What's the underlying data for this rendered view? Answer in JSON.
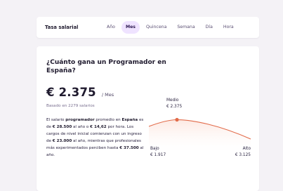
{
  "rate_bar": {
    "title": "Tasa salarial",
    "tabs": [
      "Año",
      "Mes",
      "Quincena",
      "Semana",
      "Día",
      "Hora"
    ],
    "active_tab": "Mes"
  },
  "main": {
    "question": "¿Cuánto gana un Programador en España?",
    "salary_amount": "€ 2.375",
    "salary_period": "/ Mes",
    "based_on": "Basado en 2279 salarios",
    "description": {
      "t1": "El salario ",
      "b1": "programador",
      "t2": " promedio en ",
      "b2": "España",
      "t3": " es de ",
      "b3": "€ 28.500",
      "t4": " al año o ",
      "b4": "€ 14,62",
      "t5": " por hora. Los cargos de nivel inicial comienzan con un ingreso de ",
      "b5": "€ 23.000",
      "t6": " al año, mientras que profesionales más experimentados perciben hasta ",
      "b6": "€ 37.500",
      "t7": " al año."
    },
    "chart": {
      "medio_label": "Medio",
      "medio_value": "€ 2.375",
      "bajo_label": "Bajo",
      "bajo_value": "€ 1.917",
      "alto_label": "Alto",
      "alto_value": "€ 3.125",
      "curve_color": "#e26b4a",
      "fill_color": "#fde9e2"
    }
  }
}
